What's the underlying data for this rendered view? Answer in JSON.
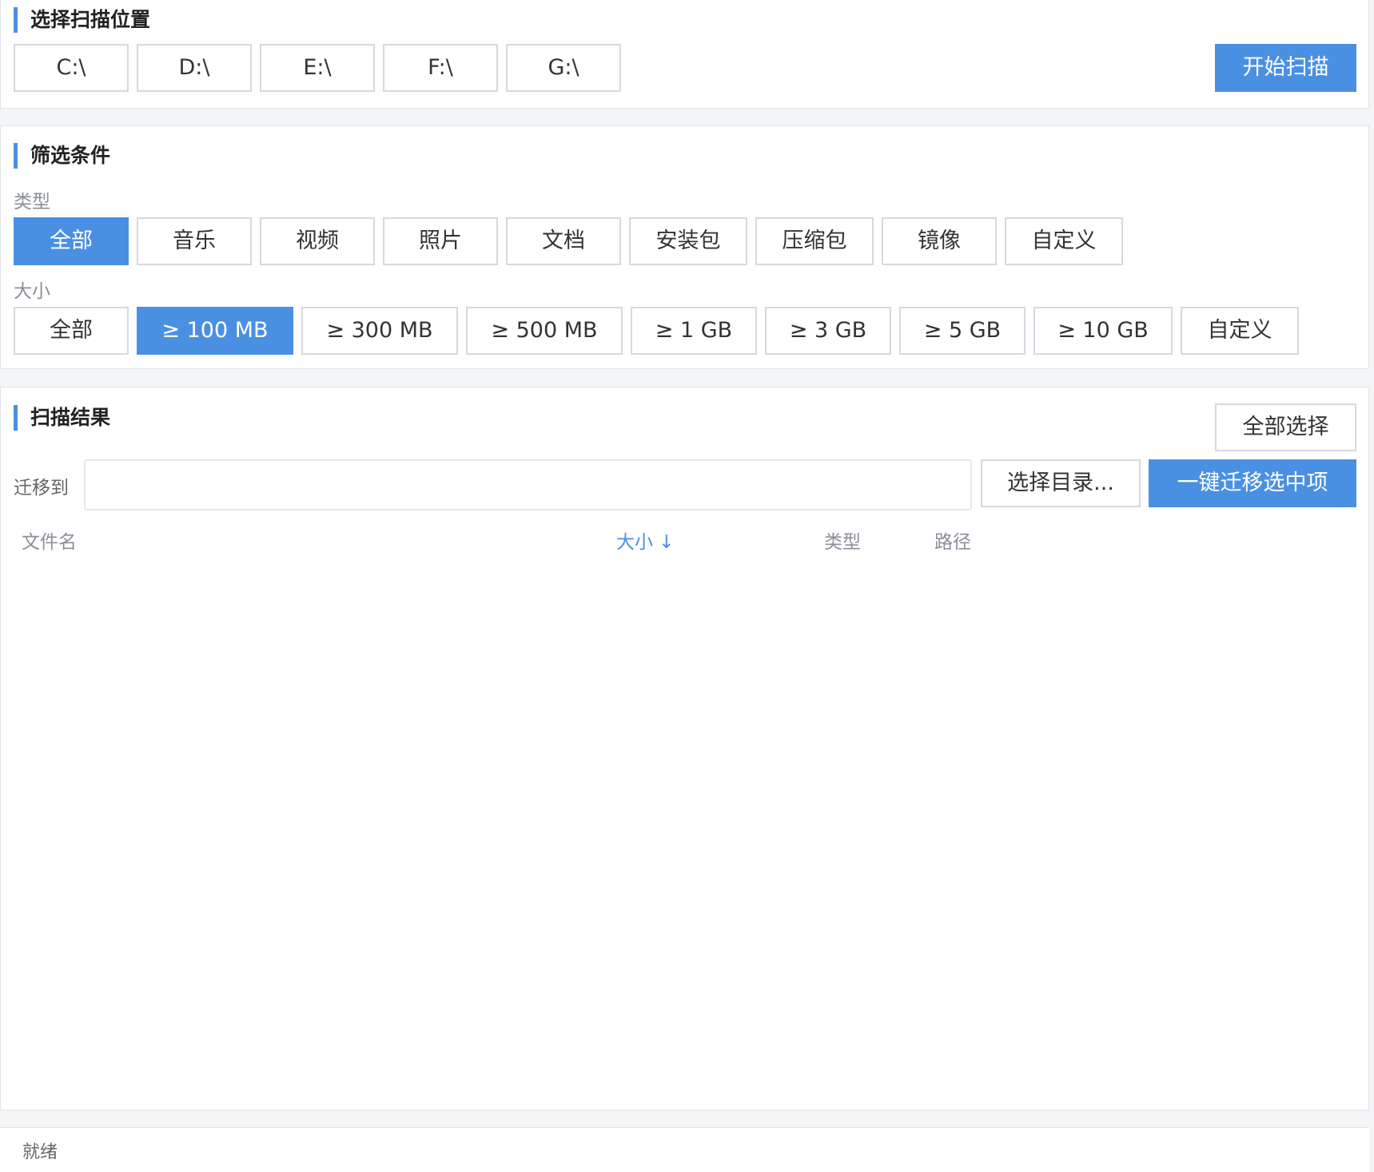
{
  "scan_location": {
    "title": "选择扫描位置",
    "drives": [
      "C:\\",
      "D:\\",
      "E:\\",
      "F:\\",
      "G:\\"
    ],
    "start_scan_label": "开始扫描"
  },
  "filters": {
    "title": "筛选条件",
    "type_label": "类型",
    "types": [
      "全部",
      "音乐",
      "视频",
      "照片",
      "文档",
      "安装包",
      "压缩包",
      "镜像",
      "自定义"
    ],
    "type_selected": "全部",
    "size_label": "大小",
    "sizes": [
      "全部",
      "≥ 100 MB",
      "≥ 300 MB",
      "≥ 500 MB",
      "≥ 1 GB",
      "≥ 3 GB",
      "≥ 5 GB",
      "≥ 10 GB",
      "自定义"
    ],
    "size_selected": "≥ 100 MB"
  },
  "results": {
    "title": "扫描结果",
    "select_all_label": "全部选择",
    "migrate_label": "迁移到",
    "migrate_path_value": "",
    "choose_dir_label": "选择目录...",
    "migrate_selected_label": "一键迁移选中项",
    "columns": {
      "name": "文件名",
      "size": "大小 ↓",
      "type": "类型",
      "path": "路径"
    },
    "rows": []
  },
  "status": {
    "text": "就绪"
  },
  "colors": {
    "accent": "#4a90e2",
    "page_background": "#f4f5f7",
    "panel_background": "#ffffff",
    "border": "#d6d9de",
    "muted_text": "#8a8f98"
  }
}
